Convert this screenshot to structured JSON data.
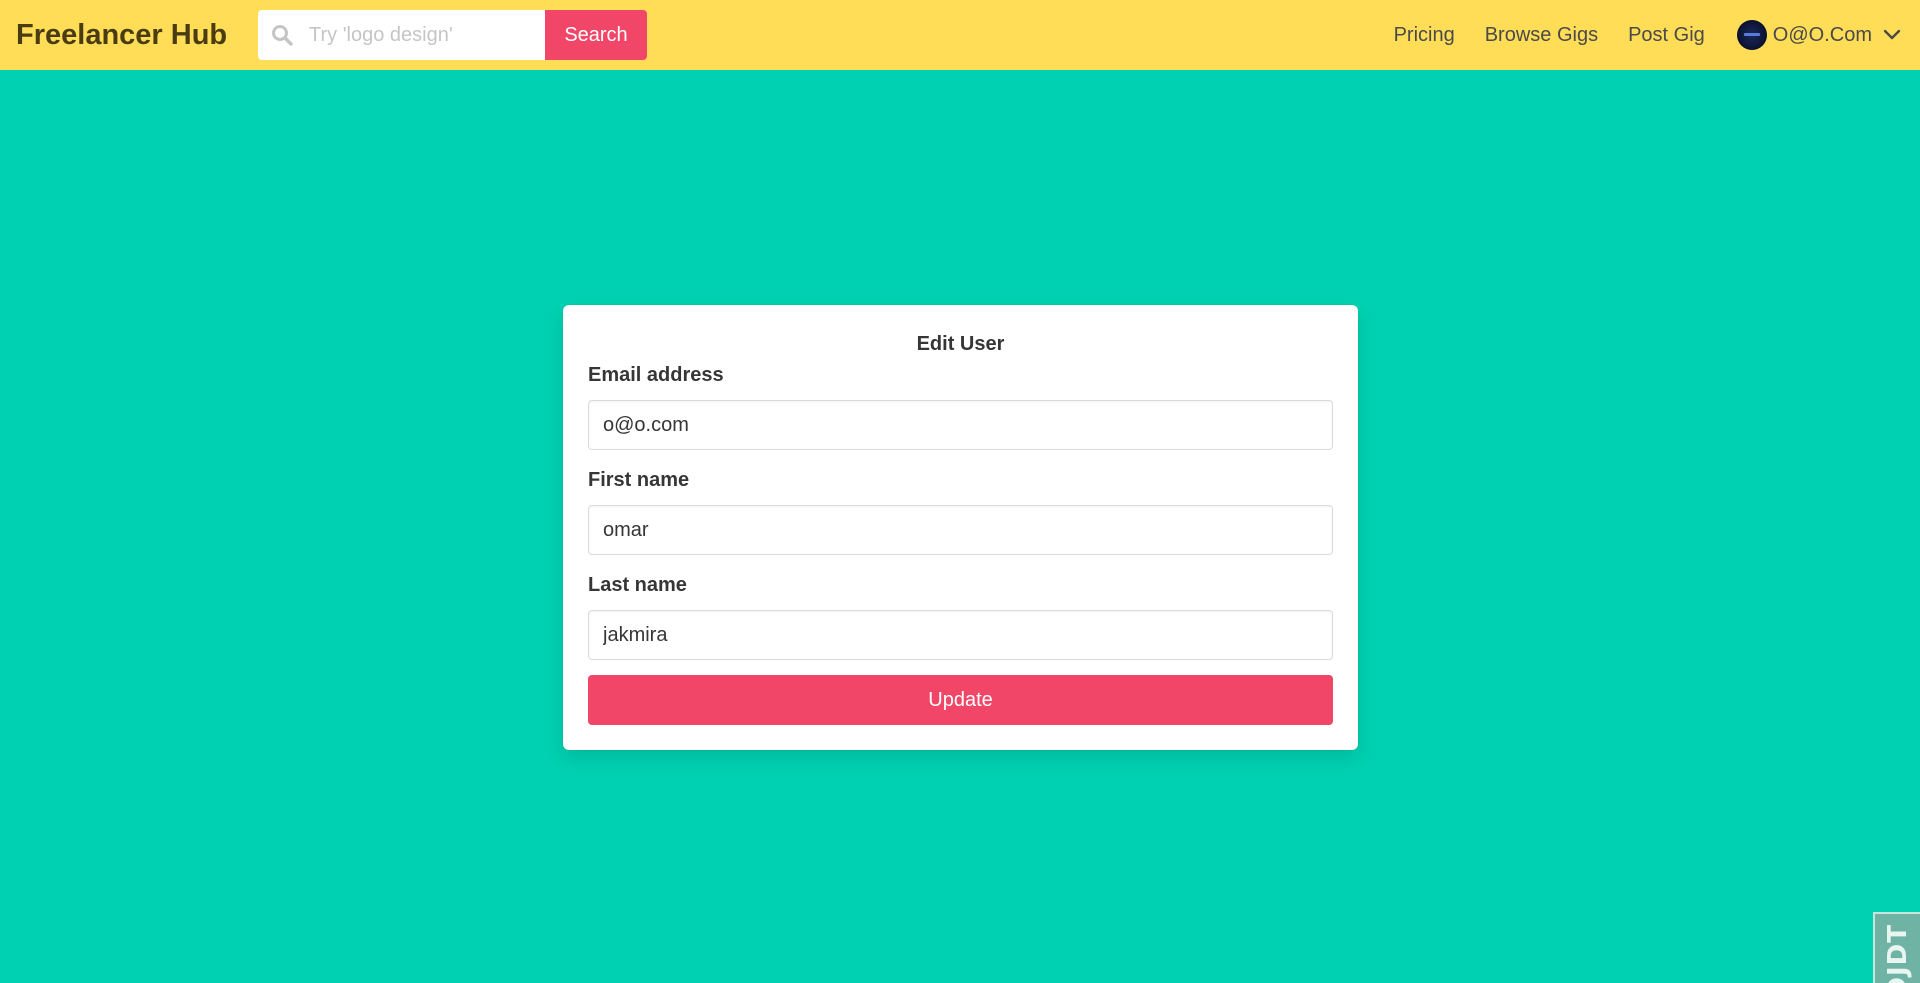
{
  "header": {
    "brand": "Freelancer Hub",
    "search": {
      "placeholder": "Try 'logo design'",
      "button_label": "Search"
    },
    "nav_links": [
      "Pricing",
      "Browse Gigs",
      "Post Gig"
    ],
    "user": {
      "name": "O@O.Com"
    }
  },
  "form": {
    "title": "Edit User",
    "email": {
      "label": "Email address",
      "value": "o@o.com"
    },
    "first_name": {
      "label": "First name",
      "value": "omar"
    },
    "last_name": {
      "label": "Last name",
      "value": "jakmira"
    },
    "submit_label": "Update"
  },
  "debug_toolbar": {
    "label": "DJDT"
  },
  "colors": {
    "navbar": "#ffdd57",
    "background": "#00d1b2",
    "accent": "#f14668"
  }
}
